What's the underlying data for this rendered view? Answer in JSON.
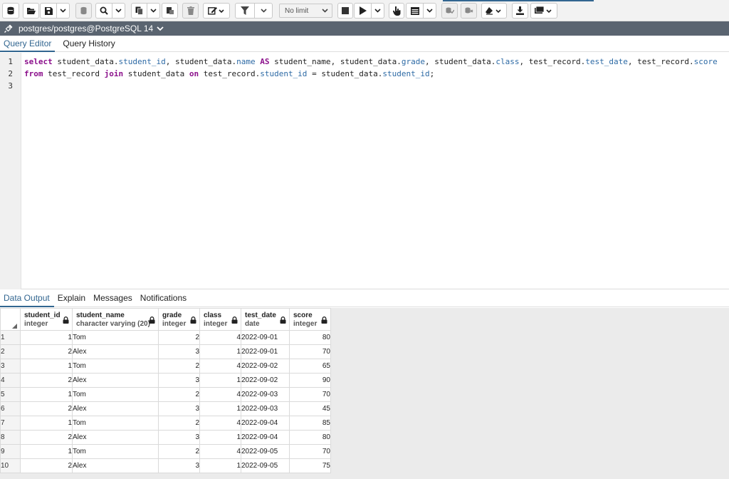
{
  "connection": {
    "label": "postgres/postgres@PostgreSQL 14"
  },
  "toolbar": {
    "limit_select": "No limit",
    "icons": [
      "database-icon",
      "folder-open-icon",
      "save-icon",
      "chevron-down-icon",
      "cylinder-icon",
      "search-icon",
      "chevron-down-icon",
      "copy-icon",
      "chevron-down-icon",
      "paste-icon",
      "trash-icon",
      "edit-icon",
      "chevron-down-icon",
      "filter-icon",
      "chevron-down-icon",
      "stop-icon",
      "play-icon",
      "chevron-down-icon",
      "cursor-icon",
      "table-icon",
      "chevron-down-icon",
      "commit-icon",
      "rollback-icon",
      "eraser-icon",
      "download-icon",
      "macro-icon"
    ]
  },
  "editor_tabs": [
    "Query Editor",
    "Query History"
  ],
  "editor": {
    "line_numbers": [
      "1",
      "2",
      "3"
    ],
    "lines": [
      "select student_data.student_id, student_data.name AS student_name, student_data.grade, student_data.class, test_record.test_date, test_record.score",
      "from test_record join student_data on test_record.student_id = student_data.student_id;",
      ""
    ]
  },
  "output_tabs": [
    "Data Output",
    "Explain",
    "Messages",
    "Notifications"
  ],
  "grid": {
    "columns": [
      {
        "name": "student_id",
        "type": "integer"
      },
      {
        "name": "student_name",
        "type": "character varying (20)"
      },
      {
        "name": "grade",
        "type": "integer"
      },
      {
        "name": "class",
        "type": "integer"
      },
      {
        "name": "test_date",
        "type": "date"
      },
      {
        "name": "score",
        "type": "integer"
      }
    ],
    "rows": [
      [
        "1",
        "1",
        "Tom",
        "2",
        "4",
        "2022-09-01",
        "80"
      ],
      [
        "2",
        "2",
        "Alex",
        "3",
        "1",
        "2022-09-01",
        "70"
      ],
      [
        "3",
        "1",
        "Tom",
        "2",
        "4",
        "2022-09-02",
        "65"
      ],
      [
        "4",
        "2",
        "Alex",
        "3",
        "1",
        "2022-09-02",
        "90"
      ],
      [
        "5",
        "1",
        "Tom",
        "2",
        "4",
        "2022-09-03",
        "70"
      ],
      [
        "6",
        "2",
        "Alex",
        "3",
        "1",
        "2022-09-03",
        "45"
      ],
      [
        "7",
        "1",
        "Tom",
        "2",
        "4",
        "2022-09-04",
        "85"
      ],
      [
        "8",
        "2",
        "Alex",
        "3",
        "1",
        "2022-09-04",
        "80"
      ],
      [
        "9",
        "1",
        "Tom",
        "2",
        "4",
        "2022-09-05",
        "70"
      ],
      [
        "10",
        "2",
        "Alex",
        "3",
        "1",
        "2022-09-05",
        "75"
      ]
    ]
  },
  "colors": {
    "accent": "#326690",
    "connection_bar": "#5a6470",
    "keyword": "#8b0f8b",
    "field": "#2d6aa5"
  }
}
